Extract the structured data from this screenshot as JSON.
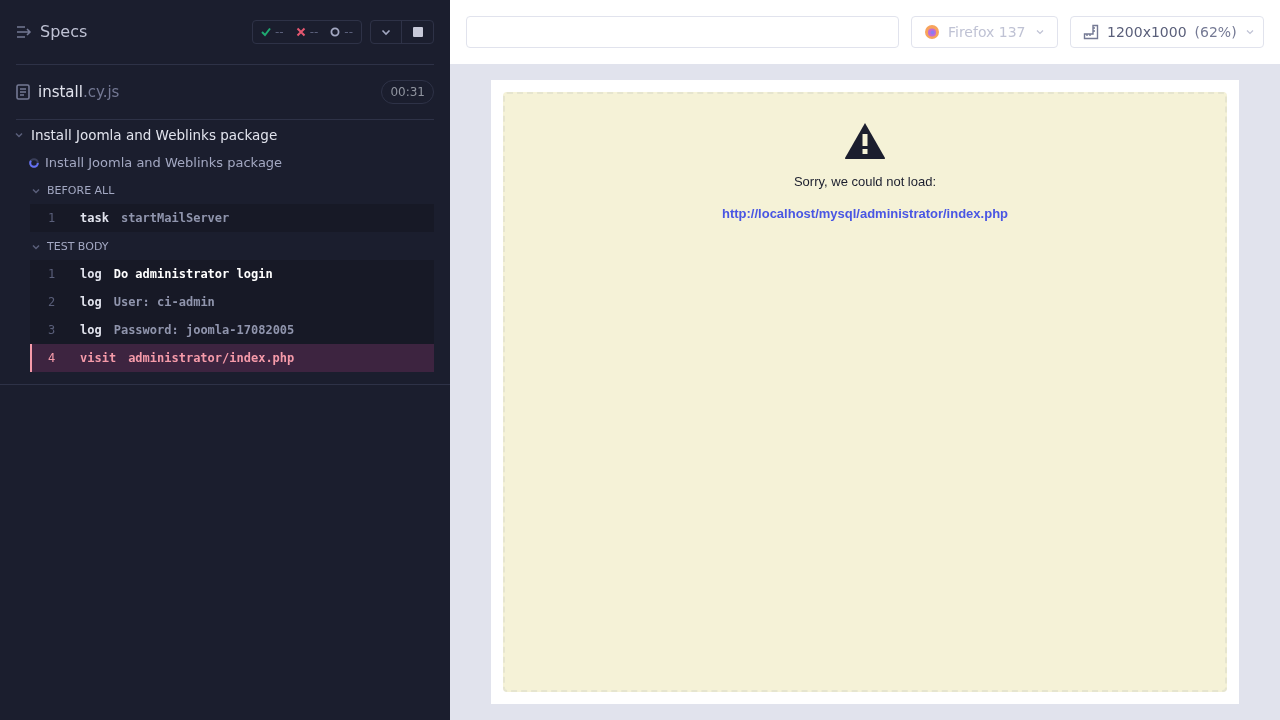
{
  "sidebar": {
    "title": "Specs",
    "stats": [
      {
        "kind": "passed",
        "value": "--"
      },
      {
        "kind": "failed",
        "value": "--"
      },
      {
        "kind": "pending",
        "value": "--"
      }
    ],
    "spec": {
      "name": "install",
      "ext": ".cy.js",
      "duration": "00:31"
    },
    "suite": {
      "title": "Install Joomla and Weblinks package",
      "expanded": true,
      "test": {
        "title": "Install Joomla and Weblinks package",
        "running": true
      },
      "hooks": [
        {
          "title": "BEFORE ALL",
          "expanded": true,
          "commands": [
            {
              "number": "1",
              "name": "task",
              "message": "startMailServer",
              "kind": "normal",
              "highlighted": false
            }
          ]
        },
        {
          "title": "TEST BODY",
          "expanded": true,
          "commands": [
            {
              "number": "1",
              "name": "log",
              "message": "Do administrator login",
              "kind": "normal",
              "highlighted": true
            },
            {
              "number": "2",
              "name": "log",
              "message": "User: ci-admin",
              "kind": "normal",
              "highlighted": false
            },
            {
              "number": "3",
              "name": "log",
              "message": "Password: joomla-17082005",
              "kind": "normal",
              "highlighted": false
            },
            {
              "number": "4",
              "name": "visit",
              "message": "administrator/index.php",
              "kind": "failed",
              "highlighted": false
            }
          ]
        }
      ]
    }
  },
  "toolbar": {
    "browser": "Firefox 137",
    "viewport": "1200x1000",
    "zoom": "(62%)"
  },
  "preview": {
    "message": "Sorry, we could not load:",
    "url": "http://localhost/mysql/administrator/index.php"
  }
}
